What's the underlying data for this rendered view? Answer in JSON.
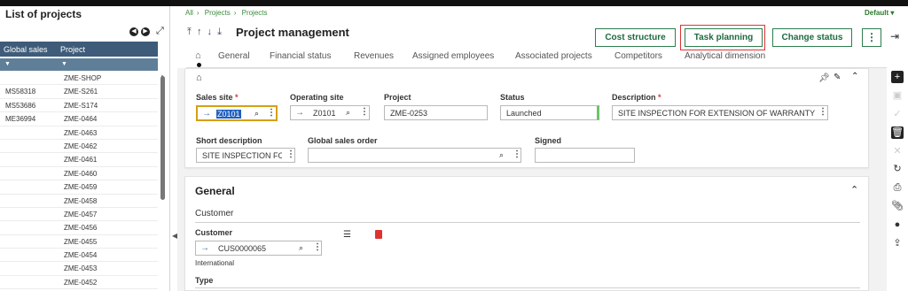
{
  "left_panel": {
    "title": "List of projects",
    "columns": [
      "Global sales",
      "Project"
    ],
    "rows": [
      {
        "global_sales": "",
        "project": "ZME-SHOP"
      },
      {
        "global_sales": "MS58318",
        "project": "ZME-S261"
      },
      {
        "global_sales": "MS53686",
        "project": "ZME-S174"
      },
      {
        "global_sales": "ME36994",
        "project": "ZME-0464"
      },
      {
        "global_sales": "",
        "project": "ZME-0463"
      },
      {
        "global_sales": "",
        "project": "ZME-0462"
      },
      {
        "global_sales": "",
        "project": "ZME-0461"
      },
      {
        "global_sales": "",
        "project": "ZME-0460"
      },
      {
        "global_sales": "",
        "project": "ZME-0459"
      },
      {
        "global_sales": "",
        "project": "ZME-0458"
      },
      {
        "global_sales": "",
        "project": "ZME-0457"
      },
      {
        "global_sales": "",
        "project": "ZME-0456"
      },
      {
        "global_sales": "",
        "project": "ZME-0455"
      },
      {
        "global_sales": "",
        "project": "ZME-0454"
      },
      {
        "global_sales": "",
        "project": "ZME-0453"
      },
      {
        "global_sales": "",
        "project": "ZME-0452"
      }
    ]
  },
  "breadcrumb": [
    "All",
    "Projects",
    "Projects"
  ],
  "view_selector": "Default",
  "page_title": "Project management",
  "action_buttons": [
    "Cost structure",
    "Task planning",
    "Change status"
  ],
  "tabs": [
    "General",
    "Financial status",
    "Revenues",
    "Assigned employees",
    "Associated projects",
    "Competitors",
    "Analytical dimension"
  ],
  "header_form": {
    "sales_site": {
      "label": "Sales site",
      "value": "Z0101"
    },
    "operating_site": {
      "label": "Operating site",
      "value": "Z0101"
    },
    "project": {
      "label": "Project",
      "value": "ZME-0253"
    },
    "status": {
      "label": "Status",
      "value": "Launched"
    },
    "description": {
      "label": "Description",
      "value": "SITE INSPECTION FOR EXTENSION OF WARRANTY L"
    },
    "short_description": {
      "label": "Short description",
      "value": "SITE INSPECTION FO"
    },
    "global_sales_order": {
      "label": "Global sales order",
      "value": ""
    },
    "signed": {
      "label": "Signed",
      "value": ""
    }
  },
  "general_section": {
    "title": "General",
    "subsection": "Customer",
    "customer_label": "Customer",
    "customer_value": "CUS0000065",
    "customer_note": "International",
    "type_label": "Type"
  },
  "colors": {
    "accent": "#1d6b3e",
    "header": "#3e5c7a",
    "required": "#d33333",
    "highlight": "#d33333"
  }
}
